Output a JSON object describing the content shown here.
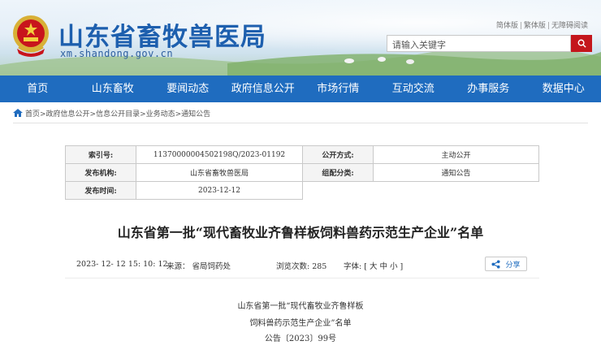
{
  "header": {
    "site_title": "山东省畜牧兽医局",
    "site_url": "xm.shandong.gov.cn",
    "links": [
      "简体版",
      "繁体版",
      "无障碍阅读"
    ],
    "search_placeholder": "请输入关键字"
  },
  "nav": {
    "items": [
      "首页",
      "山东畜牧",
      "要闻动态",
      "政府信息公开",
      "市场行情",
      "互动交流",
      "办事服务",
      "数据中心"
    ]
  },
  "breadcrumb": {
    "text": "首页>政府信息公开>信息公开目录>业务动态>通知公告"
  },
  "info_table": {
    "index_label": "索引号:",
    "index_value": "11370000004502198Q/2023-01192",
    "open_mode_label": "公开方式:",
    "open_mode_value": "主动公开",
    "publisher_label": "发布机构:",
    "publisher_value": "山东省畜牧兽医局",
    "category_label": "组配分类:",
    "category_value": "通知公告",
    "date_label": "发布时间:",
    "date_value": "2023-12-12"
  },
  "article": {
    "title": "山东省第一批“现代畜牧业齐鲁样板饲料兽药示范生产企业”名单",
    "datetime": "2023- 12- 12 15: 10: 12",
    "source": "来源： 省局饲药处",
    "views": "浏览次数: 285",
    "font_size": "字体: [ 大 中 小 ]",
    "share_label": "分享",
    "body_lines": [
      "山东省第一批“现代畜牧业齐鲁样板",
      "饲料兽药示范生产企业”名单",
      "公告〔2023〕99号"
    ]
  },
  "colors": {
    "nav_bg": "#1f6cbf",
    "title_blue": "#1d5fae",
    "search_button": "#c4161c"
  },
  "icons": [
    "national-emblem-icon",
    "search-icon",
    "home-icon",
    "share-icon"
  ]
}
